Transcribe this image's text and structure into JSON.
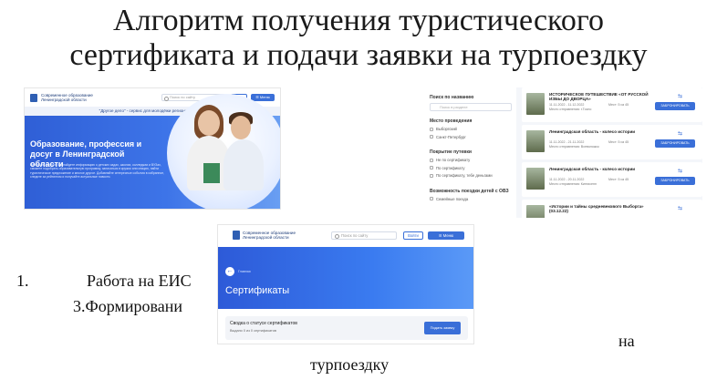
{
  "slide": {
    "title_line1": "Алгоритм получения туристического",
    "title_line2": "сертификата и подачи заявки на турпоездку",
    "item1_num": "1.",
    "item1_text": "Работа на ЕИС",
    "item3_text": "3.Формировани",
    "word_na": "на",
    "word_tur": "турпоездку"
  },
  "portal": {
    "brand_line1": "Современное образование",
    "brand_line2": "Ленинградской области",
    "search_placeholder": "Поиск по сайту",
    "login_label": "Войти",
    "menu_label": "☰ Меню"
  },
  "landing": {
    "banner": "\"Другое дело\" - сервис для молодёжи региона и страны",
    "hero_title": "Образование, профессия и досуг в Ленинградской области",
    "hero_text": "На нашем портале Вы найдете информацию о детских садах, школах, колледжах и ВУЗах, сможете подобрать образовательную программу, записаться в кружок или секцию, найти туристическое предложение и многое другое. Добавляйте интересные события в избранное, следите за рейтингом и получайте актуальные новости."
  },
  "tours": {
    "sidebar": {
      "search_heading": "Поиск по названию",
      "search_placeholder": "Поиск в разделе",
      "place_heading": "Место проведения",
      "places": [
        "Выборгский",
        "Санкт-Петербург"
      ],
      "cover_heading": "Покрытие путевки",
      "covers": [
        "Не по сертификату",
        "По сертификату",
        "По сертификату, тебе деньгами"
      ],
      "age_heading": "Возможность поездки детей с ОВЗ",
      "ages": [
        "Семейные поезда"
      ]
    },
    "cards": [
      {
        "title": "ИСТОРИЧЕСКОЕ ПУТЕШЕСТВИЕ «ОТ РУССКОЙ ИЗБЫ ДО ДВОРЦА»",
        "dates": "11.11.2022 - 11.12.2022",
        "place": "Место отправления: г.Тосно",
        "seats": "Мест: 5 из 45",
        "button": "ЗАБРОНИРОВАТЬ"
      },
      {
        "title": "Ленинградская область - колесо истории",
        "dates": "11.11.2022 - 21.11.2022",
        "place": "Место отправления: Всеволожск",
        "seats": "Мест: 5 из 45",
        "button": "ЗАБРОНИРОВАТЬ"
      },
      {
        "title": "Ленинградская область - колесо истории",
        "dates": "11.11.2022 - 20.11.2022",
        "place": "Место отправления: Кингисепп",
        "seats": "Мест: 5 из 45",
        "button": "ЗАБРОНИРОВАТЬ"
      },
      {
        "title": "«Истории и тайны средневекового Выборга» (03.12.22)",
        "dates": "",
        "place": "",
        "seats": "",
        "button": ""
      }
    ]
  },
  "certificates": {
    "breadcrumb": "Главная",
    "title": "Сертификаты",
    "panel_title": "Сводка о статусе сертификатов",
    "panel_sub": "Выдано 0 из 0 сертификатов",
    "apply_button": "Подать заявку"
  }
}
